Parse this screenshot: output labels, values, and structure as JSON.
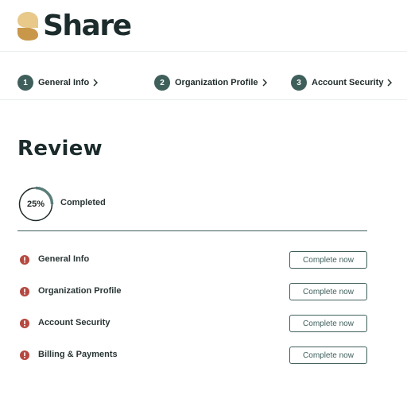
{
  "brand": {
    "name": "Share"
  },
  "steps": [
    {
      "number": "1",
      "label": "General Info"
    },
    {
      "number": "2",
      "label": "Organization Profile"
    },
    {
      "number": "3",
      "label": "Account Security"
    }
  ],
  "page": {
    "title": "Review"
  },
  "progress": {
    "value": 0.25,
    "text": "25%",
    "label": "Completed"
  },
  "colors": {
    "accent": "#3f5f5b",
    "warning": "#b5483f",
    "logo_top": "#e8c98a",
    "logo_bottom": "#c9974a"
  },
  "review_items": [
    {
      "label": "General Info",
      "action": "Complete now"
    },
    {
      "label": "Organization Profile",
      "action": "Complete now"
    },
    {
      "label": "Account Security",
      "action": "Complete now"
    },
    {
      "label": "Billing & Payments",
      "action": "Complete now"
    }
  ]
}
